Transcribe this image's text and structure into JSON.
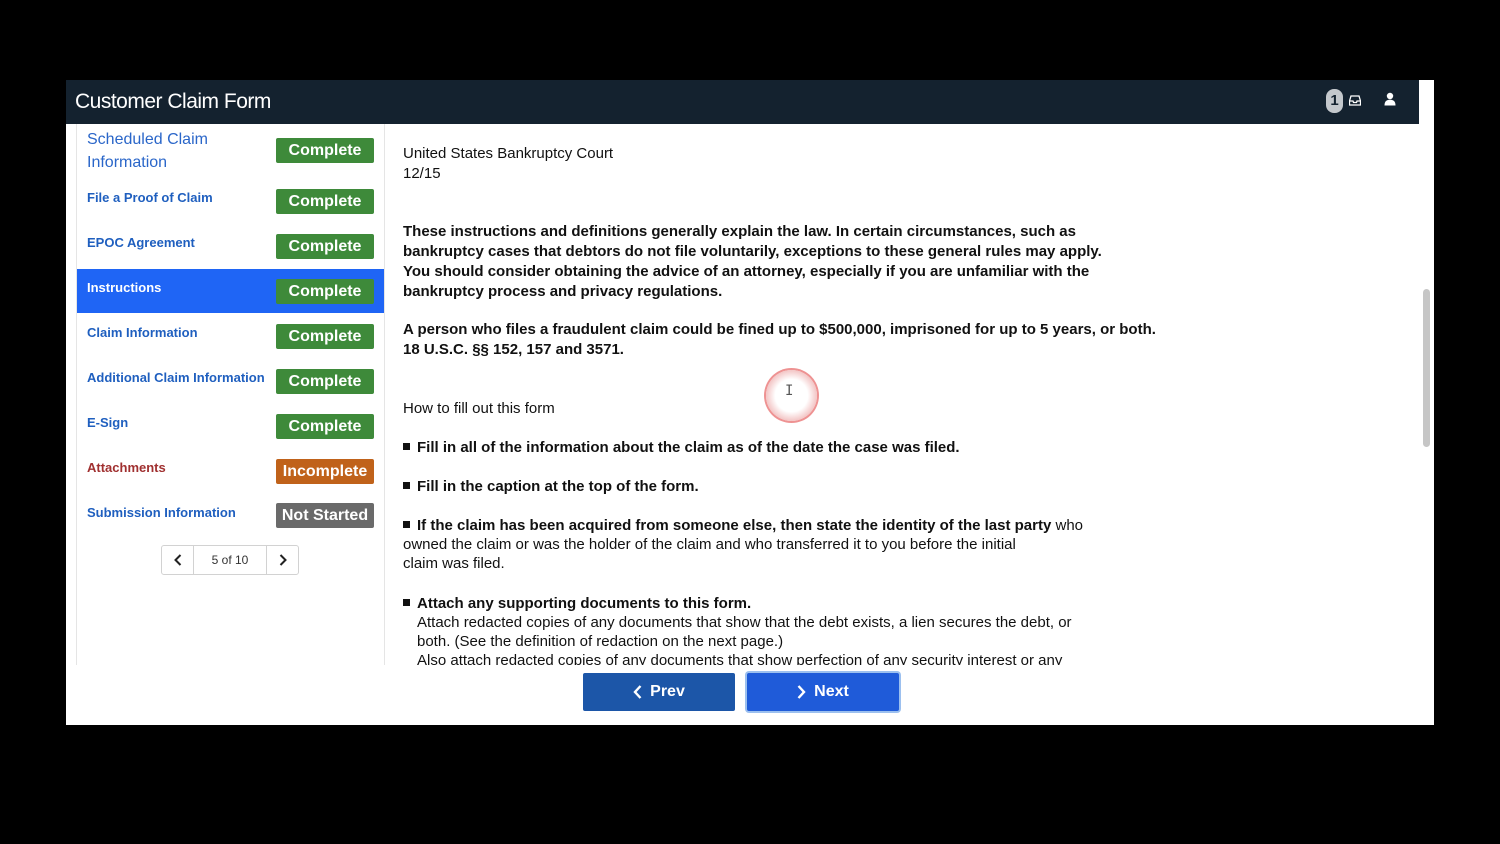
{
  "header": {
    "title": "Customer Claim Form",
    "notification_count": "1"
  },
  "sidebar": {
    "items": [
      {
        "label": "Scheduled Claim Information",
        "status": "Complete"
      },
      {
        "label": "File a Proof of Claim",
        "status": "Complete"
      },
      {
        "label": "EPOC Agreement",
        "status": "Complete"
      },
      {
        "label": "Instructions",
        "status": "Complete"
      },
      {
        "label": "Claim Information",
        "status": "Complete"
      },
      {
        "label": "Additional Claim Information",
        "status": "Complete"
      },
      {
        "label": "E-Sign",
        "status": "Complete"
      },
      {
        "label": "Attachments",
        "status": "Incomplete"
      },
      {
        "label": "Submission Information",
        "status": "Not Started"
      }
    ],
    "active_item": "Instructions",
    "pager": {
      "label": "5 of 10"
    }
  },
  "content": {
    "court": "United States Bankruptcy Court",
    "date": "12/15",
    "intro": [
      "These instructions and definitions generally explain the law. In certain circumstances, such as",
      "bankruptcy cases that debtors do not file voluntarily, exceptions to these general rules may apply.",
      "You should consider obtaining the advice of an attorney, especially if you are unfamiliar with the",
      "bankruptcy process and privacy regulations."
    ],
    "fraud": [
      "A person who files a fraudulent claim could be fined up to $500,000, imprisoned for up to 5 years, or both.",
      "18 U.S.C. §§ 152, 157 and 3571."
    ],
    "how_to": "How to fill out this form",
    "bullet1": "Fill in all of the information about the claim as of the date the case was filed.",
    "bullet2": "Fill in the caption at the top of the form.",
    "bullet3_bold": "If the claim has been acquired from someone else, then state the identity of the last party",
    "bullet3_rest": " who",
    "bullet3_lines": [
      "owned the claim or was the holder of the claim and who transferred it to you before the initial",
      "claim was filed."
    ],
    "bullet4": "Attach any supporting documents to this form.",
    "bullet4_lines": [
      "Attach redacted copies of any documents that show that the debt exists, a lien secures the debt, or",
      "both. (See the definition of redaction on the next page.)",
      "Also attach redacted copies of any documents that show perfection of any security interest or any"
    ]
  },
  "footer": {
    "prev_label": "Prev",
    "next_label": "Next"
  },
  "colors": {
    "header_bg": "#14222f",
    "active_nav": "#1f65f5",
    "complete": "#3e8a3a",
    "incomplete": "#c0621a",
    "not_started": "#6a6a6a",
    "button": "#1c56a8"
  }
}
